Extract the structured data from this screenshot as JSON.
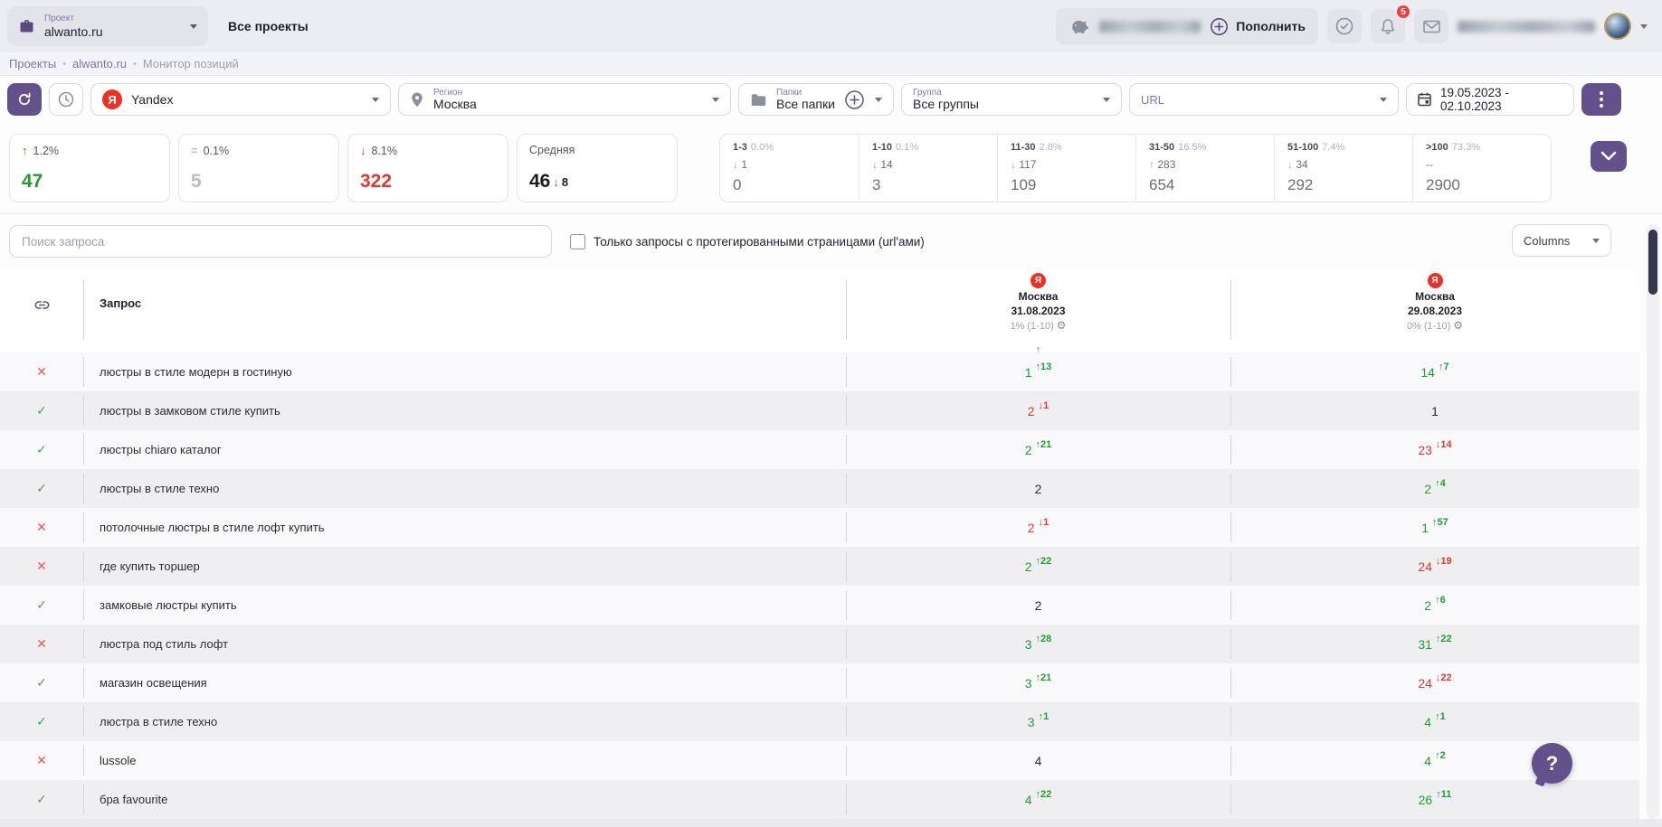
{
  "colors": {
    "accent_purple": "#63518b",
    "green": "#1f9e2e",
    "red": "#e8362e",
    "yandex_red": "#ef3124",
    "gray_text": "#9da1ab"
  },
  "icons": {
    "up_arrow": "↑",
    "down_arrow": "↓",
    "equals": "=",
    "check": "✓",
    "cross": "✕",
    "sort_up": "↑",
    "gear": "⚙",
    "dot_separator": "•",
    "question": "?",
    "no_change": "--"
  },
  "topbar": {
    "project_label": "Проект",
    "project_value": "alwanto.ru",
    "all_projects_label": "Все проекты",
    "topup_label": "Пополнить",
    "notifications_badge": "5"
  },
  "breadcrumb": {
    "items": [
      "Проекты",
      "alwanto.ru",
      "Монитор позиций"
    ]
  },
  "filters": {
    "engine_letter": "Я",
    "engine_value": "Yandex",
    "region_label": "Регион",
    "region_value": "Москва",
    "folders_label": "Папки",
    "folders_value": "Все папки",
    "group_label": "Группа",
    "group_value": "Все группы",
    "url_label": "URL",
    "date_range": "19.05.2023 - 02.10.2023"
  },
  "stats": {
    "summary": [
      {
        "percent": "1.2%",
        "value": "47"
      },
      {
        "percent": "0.1%",
        "value": "5"
      },
      {
        "percent": "8.1%",
        "value": "322"
      },
      {
        "label": "Средняя",
        "value": "46",
        "delta": "8"
      }
    ],
    "buckets": [
      {
        "range": "1-3",
        "percent": "0.0%",
        "delta": "1",
        "dir": "down",
        "value": "0"
      },
      {
        "range": "1-10",
        "percent": "0.1%",
        "delta": "14",
        "dir": "down",
        "value": "3"
      },
      {
        "range": "11-30",
        "percent": "2.8%",
        "delta": "117",
        "dir": "down",
        "value": "109"
      },
      {
        "range": "31-50",
        "percent": "16.5%",
        "delta": "283",
        "dir": "up",
        "value": "654"
      },
      {
        "range": "51-100",
        "percent": "7.4%",
        "delta": "34",
        "dir": "down",
        "value": "292"
      },
      {
        "range": ">100",
        "percent": "73.3%",
        "delta": "--",
        "dir": "none",
        "value": "2900"
      }
    ]
  },
  "controls": {
    "search_placeholder": "Поиск запроса",
    "checkbox_label": "Только запросы с протегированными страницами (url'ами)",
    "columns_label": "Columns"
  },
  "table": {
    "query_header": "Запрос",
    "columns": [
      {
        "engine": "Я",
        "city": "Москва",
        "date": "31.08.2023",
        "meta": "1% (1-10)",
        "sorted": true
      },
      {
        "engine": "Я",
        "city": "Москва",
        "date": "29.08.2023",
        "meta": "0% (1-10)",
        "sorted": false
      }
    ],
    "rows": [
      {
        "status": "fail",
        "query": "люстры в стиле модерн в гостиную",
        "cells": [
          {
            "pos": "1",
            "delta": "13",
            "dir": "up"
          },
          {
            "pos": "14",
            "delta": "7",
            "dir": "up"
          }
        ]
      },
      {
        "status": "ok",
        "query": "люстры в замковом стиле купить",
        "cells": [
          {
            "pos": "2",
            "delta": "1",
            "dir": "down"
          },
          {
            "pos": "1",
            "delta": "",
            "dir": "none"
          }
        ]
      },
      {
        "status": "ok",
        "query": "люстры chiaro каталог",
        "cells": [
          {
            "pos": "2",
            "delta": "21",
            "dir": "up"
          },
          {
            "pos": "23",
            "delta": "14",
            "dir": "down"
          }
        ]
      },
      {
        "status": "ok",
        "query": "люстры в стиле техно",
        "cells": [
          {
            "pos": "2",
            "delta": "",
            "dir": "none"
          },
          {
            "pos": "2",
            "delta": "4",
            "dir": "up"
          }
        ]
      },
      {
        "status": "fail",
        "query": "потолочные люстры в стиле лофт купить",
        "cells": [
          {
            "pos": "2",
            "delta": "1",
            "dir": "down"
          },
          {
            "pos": "1",
            "delta": "57",
            "dir": "up"
          }
        ]
      },
      {
        "status": "fail",
        "query": "где купить торшер",
        "cells": [
          {
            "pos": "2",
            "delta": "22",
            "dir": "up"
          },
          {
            "pos": "24",
            "delta": "19",
            "dir": "down"
          }
        ]
      },
      {
        "status": "ok",
        "query": "замковые люстры купить",
        "cells": [
          {
            "pos": "2",
            "delta": "",
            "dir": "none"
          },
          {
            "pos": "2",
            "delta": "6",
            "dir": "up"
          }
        ]
      },
      {
        "status": "fail",
        "query": "люстра под стиль лофт",
        "cells": [
          {
            "pos": "3",
            "delta": "28",
            "dir": "up"
          },
          {
            "pos": "31",
            "delta": "22",
            "dir": "up"
          }
        ]
      },
      {
        "status": "ok",
        "query": "магазин освещения",
        "cells": [
          {
            "pos": "3",
            "delta": "21",
            "dir": "up"
          },
          {
            "pos": "24",
            "delta": "22",
            "dir": "down"
          }
        ]
      },
      {
        "status": "ok",
        "query": "люстра в стиле техно",
        "cells": [
          {
            "pos": "3",
            "delta": "1",
            "dir": "up"
          },
          {
            "pos": "4",
            "delta": "1",
            "dir": "up"
          }
        ]
      },
      {
        "status": "fail",
        "query": "lussole",
        "cells": [
          {
            "pos": "4",
            "delta": "",
            "dir": "none"
          },
          {
            "pos": "4",
            "delta": "2",
            "dir": "up"
          }
        ]
      },
      {
        "status": "ok",
        "query": "бра favourite",
        "cells": [
          {
            "pos": "4",
            "delta": "22",
            "dir": "up"
          },
          {
            "pos": "26",
            "delta": "11",
            "dir": "up"
          }
        ]
      }
    ]
  }
}
